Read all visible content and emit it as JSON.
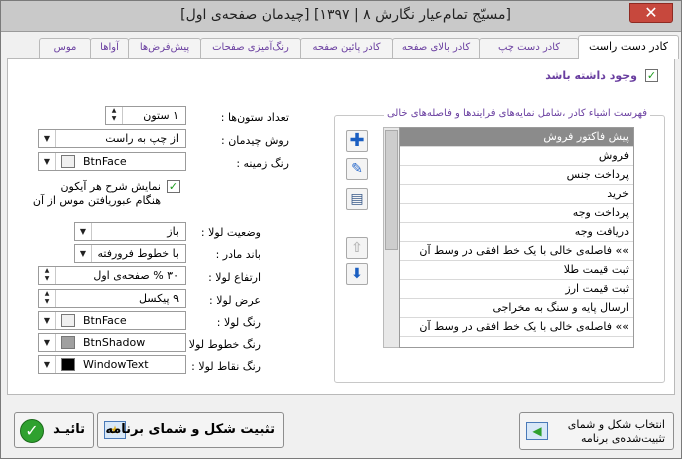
{
  "window": {
    "title": "[مسیّج تمام‌عیار نگارش ۸ | ۱۳۹۷] [چیدمان صفحه‌ی اول]",
    "close_label": "✕"
  },
  "tabs": [
    {
      "label": "کادر دست راست"
    },
    {
      "label": "کادر دست چپ"
    },
    {
      "label": "کادر بالای صفحه"
    },
    {
      "label": "کادر پائین صفحه"
    },
    {
      "label": "رنگ‌آمیزی صفحات"
    },
    {
      "label": "پیش‌فرض‌ها"
    },
    {
      "label": "آواها"
    },
    {
      "label": "موس"
    }
  ],
  "panel": {
    "has_frame_label": "وجود داشته باشد",
    "columns_label": "تعداد ستون‌ها :",
    "columns_value": "۱ ستون",
    "layout_label": "روش چیدمان :",
    "layout_value": "از چپ به راست",
    "bg_color_label": "رنگ زمینه :",
    "bg_color_value": "BtnFace",
    "show_desc_line1": "نمایش شرح هر آیکون",
    "show_desc_line2": "هنگام عبوریافتن موس از آن",
    "hinge_state_label": "وضعیت لولا :",
    "hinge_state_value": "باز",
    "parent_band_label": "باند مادر :",
    "parent_band_value": "با خطوط فرورفته",
    "hinge_height_label": "ارتفاع لولا :",
    "hinge_height_value": "۳۰ % صفحه‌ی اول",
    "hinge_width_label": "عرض لولا :",
    "hinge_width_value": "۹ پیکسل",
    "hinge_color_label": "رنگ لولا :",
    "hinge_color_value": "BtnFace",
    "hinge_line_label": "رنگ خطوط لولا :",
    "hinge_line_value": "BtnShadow",
    "hinge_dot_label": "رنگ نقاط لولا :",
    "hinge_dot_value": "WindowText",
    "group_title": "فهرست اشیاء کادر ،شامل نمایه‌های فرایندها و فاصله‌های خالی",
    "list_items": [
      "پیش فاکتور فروش",
      "فروش",
      "پرداخت جنس",
      "خرید",
      "پرداخت وجه",
      "دریافت وجه",
      "»» فاصله‌ی خالی با یک خط افقی در وسط آن",
      "ثبت قیمت طلا",
      "ثبت قیمت ارز",
      "ارسال پایه و سنگ به مخراجی",
      "»» فاصله‌ی خالی با یک خط افقی در وسط آن"
    ]
  },
  "buttons": {
    "ok": "تائیـد",
    "fix_shape": "تثبیت شکل و شمای برنامه",
    "choose_line1": "انتخاب شکل و شمای",
    "choose_line2": "تثبیت‌شده‌ی برنامه"
  },
  "colors": {
    "accent_purple": "#6a3fa0",
    "check_green": "#1a9a1a",
    "btnface": "#f0f0f0",
    "btnshadow": "#a0a0a0",
    "windowtext": "#000000"
  }
}
